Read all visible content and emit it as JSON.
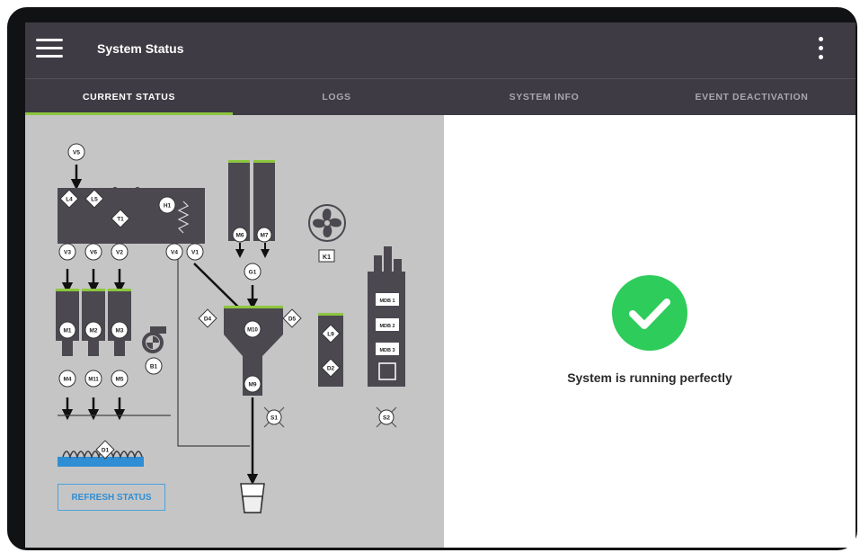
{
  "header": {
    "title": "System Status"
  },
  "tabs": [
    {
      "label": "CURRENT STATUS",
      "active": true
    },
    {
      "label": "LOGS",
      "active": false
    },
    {
      "label": "SYSTEM INFO",
      "active": false
    },
    {
      "label": "EVENT DEACTIVATION",
      "active": false
    }
  ],
  "status": {
    "message": "System is running perfectly",
    "icon": "check-circle-icon",
    "color": "#2ecc5a"
  },
  "diagram": {
    "valves": [
      "V5",
      "V3",
      "V6",
      "V2",
      "V4",
      "V1"
    ],
    "levels": [
      "L4",
      "L5",
      "L9"
    ],
    "temperature": "T1",
    "heater": "H1",
    "motors": [
      "M1",
      "M2",
      "M3",
      "M4",
      "M11",
      "M5",
      "M6",
      "M7",
      "M10",
      "M9"
    ],
    "gate": "G1",
    "fan": "K1",
    "blower": "B1",
    "doors": [
      "D4",
      "D5",
      "D2",
      "D1"
    ],
    "mdb": [
      "MDB 1",
      "MDB 2",
      "MDB 3"
    ],
    "sensors": [
      "S1",
      "S2"
    ]
  },
  "actions": {
    "refresh_label": "REFRESH STATUS"
  },
  "colors": {
    "header": "#3f3b44",
    "accent": "#8dc63f",
    "machine": "#4b4850",
    "panel": "#c5c5c5",
    "link": "#2f8ed4"
  }
}
